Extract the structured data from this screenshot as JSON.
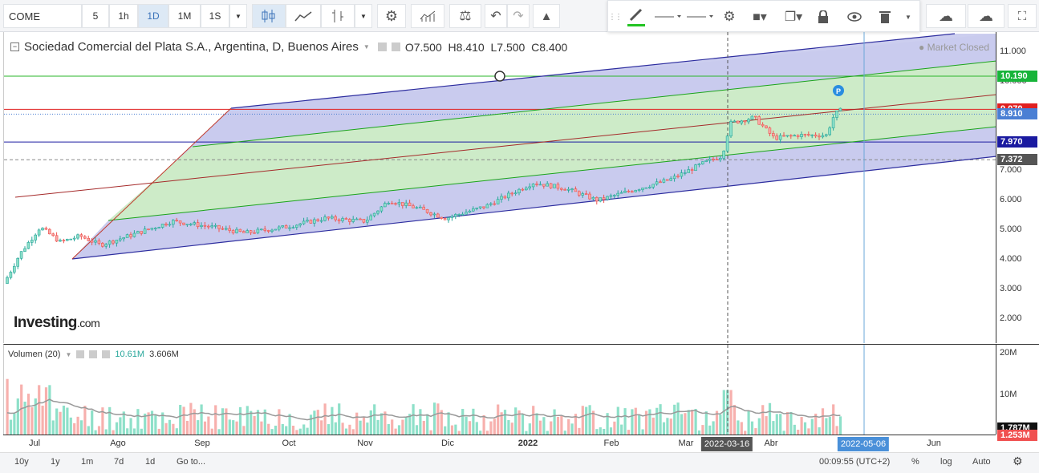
{
  "toolbar": {
    "symbol": "COME",
    "intervals": [
      "5",
      "1h",
      "1D",
      "1M",
      "1S"
    ],
    "active_interval": "1D"
  },
  "legend": {
    "title": "Sociedad Comercial del Plata S.A., Argentina, D, Buenos Aires",
    "open_label": "O",
    "open": "7.500",
    "high_label": "H",
    "high": "8.410",
    "low_label": "L",
    "low": "7.500",
    "close_label": "C",
    "close": "8.400",
    "market_status": "Market Closed"
  },
  "volume_legend": {
    "title": "Volumen (20)",
    "value1": "10.61M",
    "value2": "3.606M"
  },
  "brand": {
    "name": "Investing",
    "suffix": ".com"
  },
  "price_axis": {
    "ticks": [
      "11.000",
      "10.000",
      "9.000",
      "8.000",
      "7.000",
      "6.000",
      "5.000",
      "4.000",
      "3.000",
      "2.000"
    ],
    "labels": [
      {
        "text": "10.190",
        "color": "#18b43a"
      },
      {
        "text": "9.070",
        "color": "#e02020"
      },
      {
        "text": "8.910",
        "color": "#4a7fd4"
      },
      {
        "text": "7.970",
        "color": "#1a1aa0"
      },
      {
        "text": "7.372",
        "color": "#555555"
      }
    ]
  },
  "volume_axis": {
    "ticks": [
      "20M",
      "10M"
    ],
    "labels": [
      {
        "text": "1.787M",
        "color": "#111111"
      },
      {
        "text": "1.253M",
        "color": "#f05050"
      }
    ]
  },
  "time_axis": {
    "labels": [
      "Jul",
      "Ago",
      "Sep",
      "Oct",
      "Nov",
      "Dic",
      "2022",
      "Feb",
      "Mar",
      "Abr",
      "Jun"
    ],
    "cursor_date": "2022-03-16",
    "cursor_date2": "2022-05-06"
  },
  "bottom_bar": {
    "ranges": [
      "10y",
      "1y",
      "1m",
      "7d",
      "1d"
    ],
    "goto": "Go to...",
    "clock": "00:09:55 (UTC+2)",
    "percent": "%",
    "log": "log",
    "auto": "Auto"
  },
  "colors": {
    "up": "#26a69a",
    "down": "#ef5350",
    "channel_outer": "#2d2d9f",
    "channel_inner": "#1aa31a",
    "median": "#a52a2a"
  }
}
